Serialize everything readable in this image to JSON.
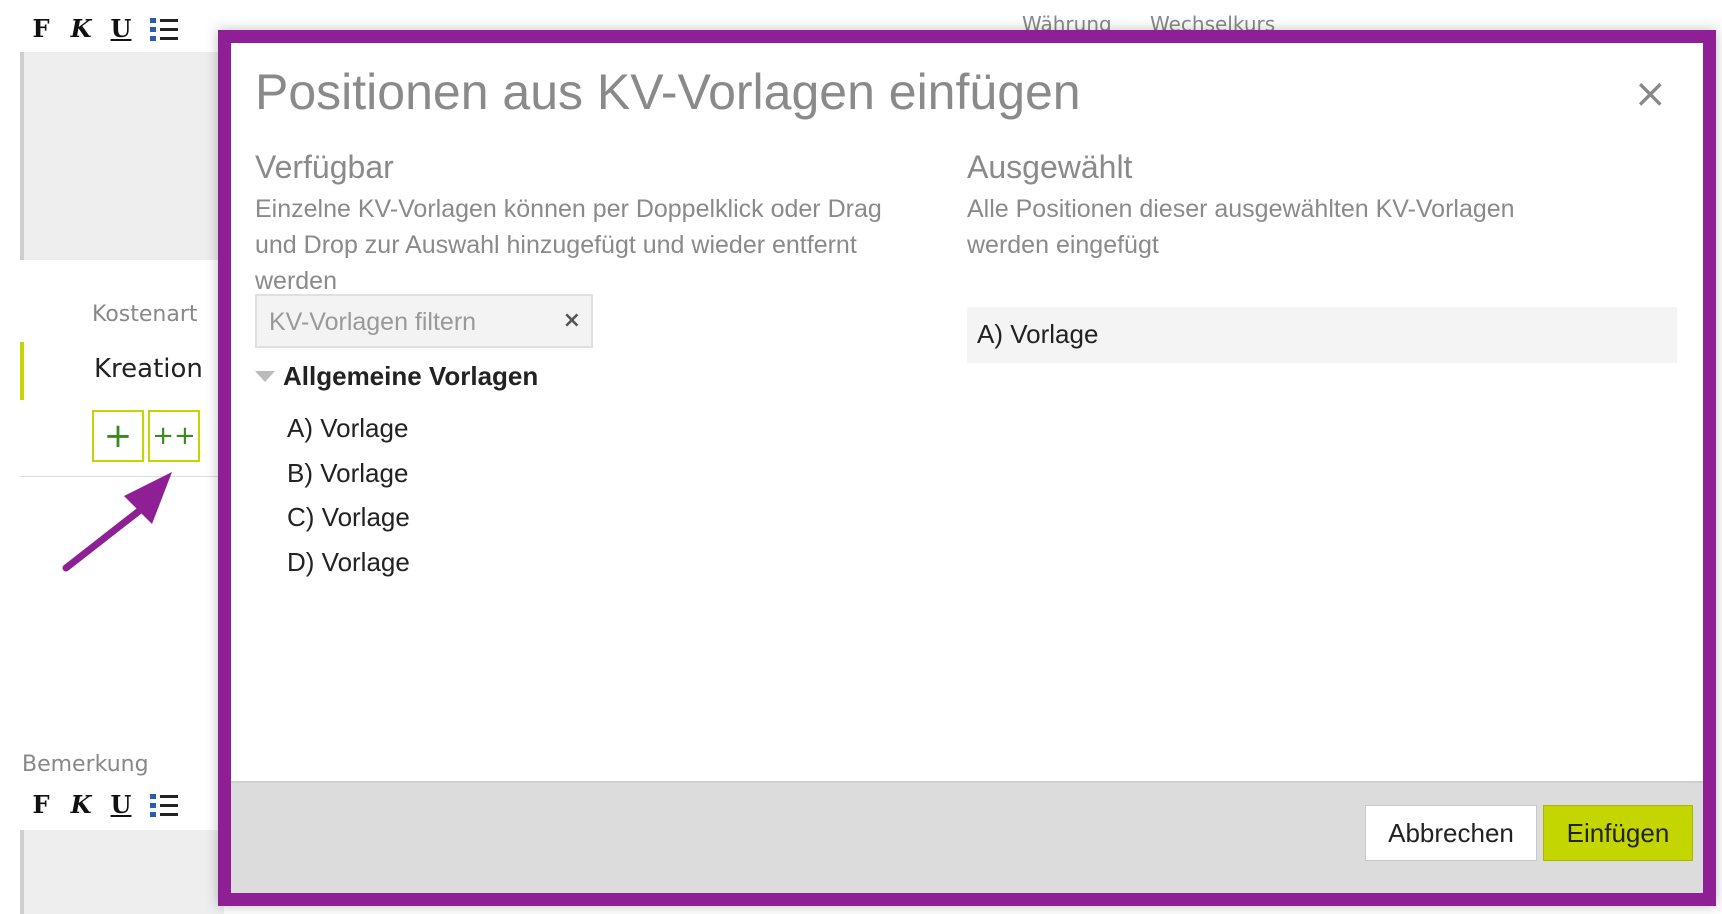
{
  "background": {
    "toolbar_buttons": {
      "bold": "F",
      "italic": "K",
      "underline": "U"
    },
    "kostenart_label": "Kostenart",
    "kreation_label": "Kreation",
    "add_button": "+",
    "add_multi_button": "++",
    "bemerkung_label": "Bemerkung",
    "header_waehrung": "Währung",
    "header_wechselkurs": "Wechselkurs",
    "accent_color": "#c3d600",
    "arrow_color": "#8e1f94"
  },
  "dialog": {
    "title": "Positionen aus KV-Vorlagen einfügen",
    "close_glyph": "×",
    "available": {
      "title": "Verfügbar",
      "description": "Einzelne KV-Vorlagen können per Doppelklick oder Drag und Drop zur Auswahl hinzugefügt und wieder entfernt werden",
      "filter_placeholder": "KV-Vorlagen filtern",
      "filter_clear_glyph": "×",
      "group_label": "Allgemeine Vorlagen",
      "items": [
        "A) Vorlage",
        "B) Vorlage",
        "C) Vorlage",
        "D) Vorlage"
      ]
    },
    "selected": {
      "title": "Ausgewählt",
      "description": "Alle Positionen dieser ausgewählten KV-Vorlagen werden eingefügt",
      "items": [
        "A) Vorlage"
      ]
    },
    "footer": {
      "cancel_label": "Abbrechen",
      "insert_label": "Einfügen"
    },
    "border_color": "#8e1f94"
  }
}
